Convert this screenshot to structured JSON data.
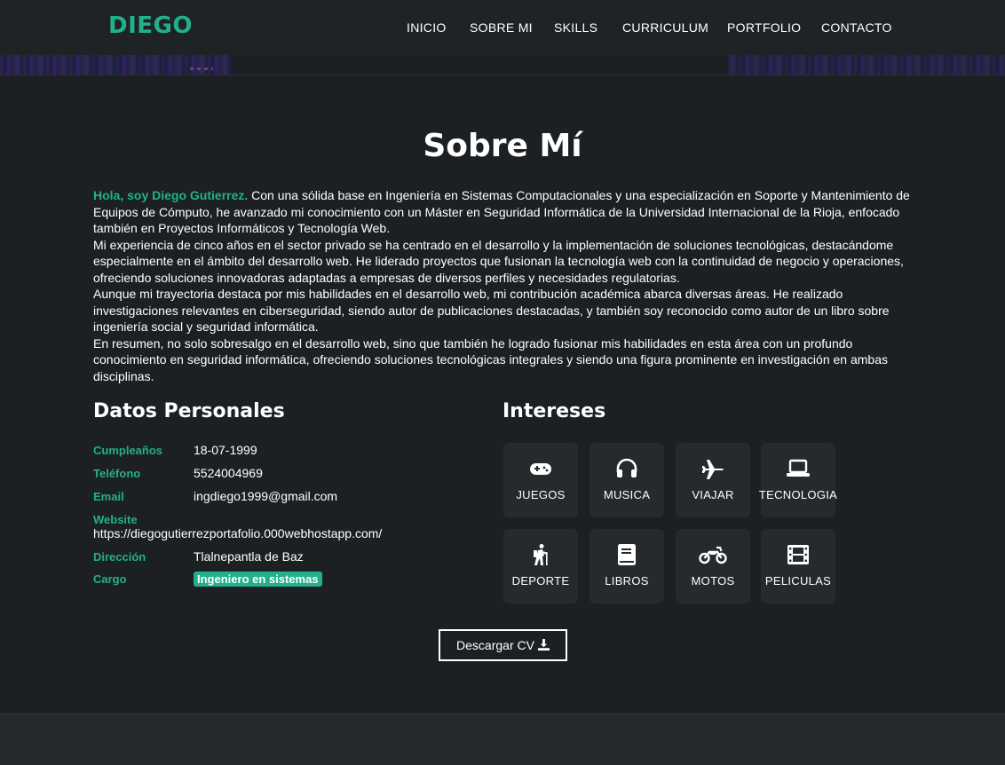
{
  "header": {
    "logo": "DIEGO",
    "nav": [
      "INICIO",
      "SOBRE MI",
      "SKILLS",
      "CURRICULUM",
      "PORTFOLIO",
      "CONTACTO"
    ]
  },
  "about": {
    "title": "Sobre Mí",
    "intro_highlight": "Hola, soy Diego Gutierrez.",
    "intro_rest": " Con una sólida base en Ingeniería en Sistemas Computacionales y una especialización en Soporte y Mantenimiento de Equipos de Cómputo, he avanzado mi conocimiento con un Máster en Seguridad Informática de la Universidad Internacional de la Rioja, enfocado también en Proyectos Informáticos y Tecnología Web.",
    "p2": "Mi experiencia de cinco años en el sector privado se ha centrado en el desarrollo y la implementación de soluciones tecnológicas, destacándome especialmente en el ámbito del desarrollo web. He liderado proyectos que fusionan la tecnología web con la continuidad de negocio y operaciones, ofreciendo soluciones innovadoras adaptadas a empresas de diversos perfiles y necesidades regulatorias.",
    "p3": "Aunque mi trayectoria destaca por mis habilidades en el desarrollo web, mi contribución académica abarca diversas áreas. He realizado investigaciones relevantes en ciberseguridad, siendo autor de publicaciones destacadas, y también soy reconocido como autor de un libro sobre ingeniería social y seguridad informática.",
    "p4": "En resumen, no solo sobresalgo en el desarrollo web, sino que también he logrado fusionar mis habilidades en esta área con un profundo conocimiento en seguridad informática, ofreciendo soluciones tecnológicas integrales y siendo una figura prominente en investigación en ambas disciplinas."
  },
  "personal": {
    "title": "Datos Personales",
    "birthday_label": "Cumpleaños",
    "birthday": "18-07-1999",
    "phone_label": "Teléfono",
    "phone": "5524004969",
    "email_label": "Email",
    "email": "ingdiego1999@gmail.com",
    "website_label": "Website",
    "website": "https://diegogutierrezportafolio.000webhostapp.com/",
    "address_label": "Dirección",
    "address": "Tlalnepantla de Baz",
    "role_label": "Cargo",
    "role": "Ingeniero en sistemas"
  },
  "interests": {
    "title": "Intereses",
    "items": [
      {
        "label": "JUEGOS",
        "icon": "gamepad-icon"
      },
      {
        "label": "MUSICA",
        "icon": "headphones-icon"
      },
      {
        "label": "VIAJAR",
        "icon": "plane-icon"
      },
      {
        "label": "TECNOLOGIA",
        "icon": "laptop-icon"
      },
      {
        "label": "DEPORTE",
        "icon": "hiking-icon"
      },
      {
        "label": "LIBROS",
        "icon": "book-icon"
      },
      {
        "label": "MOTOS",
        "icon": "motorcycle-icon"
      },
      {
        "label": "PELICULAS",
        "icon": "film-icon"
      }
    ]
  },
  "cv_button": "Descargar CV",
  "colors": {
    "accent": "#22b08c",
    "background": "#1c2022",
    "tile": "#262a2d"
  }
}
